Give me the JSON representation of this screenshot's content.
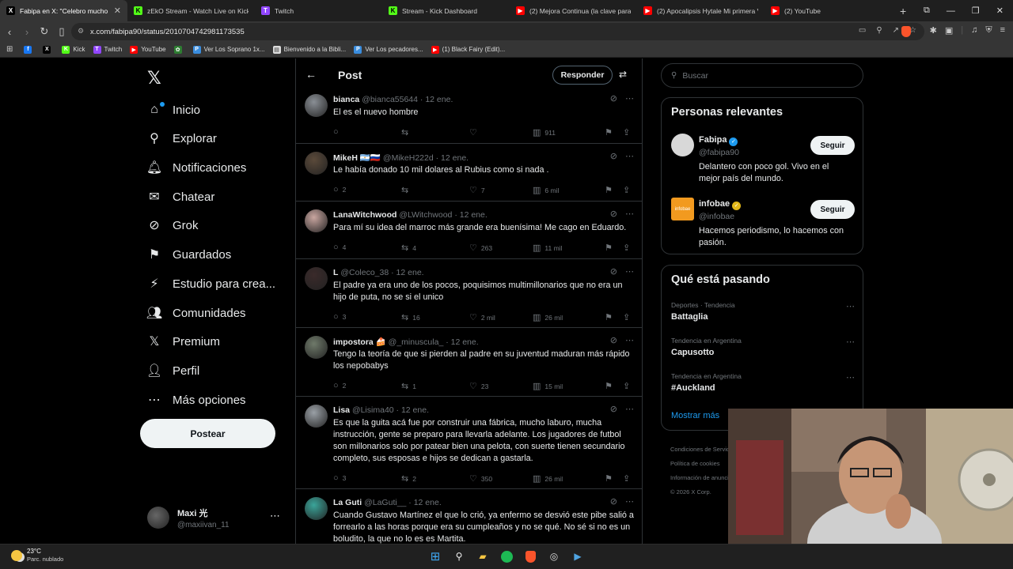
{
  "browser": {
    "tabs": [
      {
        "label": "Fabipa en X: \"Celebro mucho",
        "favicon": "X",
        "fav_color": "#000000",
        "active": true
      },
      {
        "label": "zEkO Stream - Watch Live on Kick",
        "favicon": "K",
        "fav_color": "#53fc18",
        "active": false
      },
      {
        "label": "Twitch",
        "favicon": "T",
        "fav_color": "#9146ff",
        "active": false
      },
      {
        "label": "Stream - Kick Dashboard",
        "favicon": "K",
        "fav_color": "#53fc18",
        "active": false
      },
      {
        "label": "(2) Mejora Continua (la clave para pr",
        "favicon": "▶",
        "fav_color": "#ff0000",
        "active": false
      },
      {
        "label": "(2) Apocalipsis Hytale Mi primera Ve",
        "favicon": "▶",
        "fav_color": "#ff0000",
        "active": false
      },
      {
        "label": "(2) YouTube",
        "favicon": "▶",
        "fav_color": "#ff0000",
        "active": false
      }
    ],
    "url": "x.com/fabipa90/status/2010704742981173535",
    "bookmarks": [
      {
        "label": "",
        "color": "#1877f2",
        "icon": "f"
      },
      {
        "label": "",
        "color": "#000000",
        "icon": "X"
      },
      {
        "label": "Kick",
        "color": "#53fc18",
        "icon": "K"
      },
      {
        "label": "Twitch",
        "color": "#9146ff",
        "icon": "T"
      },
      {
        "label": "YouTube",
        "color": "#ff0000",
        "icon": "▶"
      },
      {
        "label": "",
        "color": "#2e7d32",
        "icon": "✿"
      },
      {
        "label": "Ver Los Soprano 1x...",
        "color": "#3a8dde",
        "icon": "P"
      },
      {
        "label": "Bienvenido a la Bibli...",
        "color": "#dddddd",
        "icon": "▤"
      },
      {
        "label": "Ver Los pecadores...",
        "color": "#3a8dde",
        "icon": "P"
      },
      {
        "label": "(1) Black Fairy (Edit)...",
        "color": "#ff0000",
        "icon": "▶"
      }
    ]
  },
  "sidebar": {
    "items": [
      {
        "label": "Inicio",
        "icon": "home-icon",
        "glyph": "⌂"
      },
      {
        "label": "Explorar",
        "icon": "search-icon",
        "glyph": "⚲"
      },
      {
        "label": "Notificaciones",
        "icon": "bell-icon",
        "glyph": "🔔︎"
      },
      {
        "label": "Chatear",
        "icon": "chat-icon",
        "glyph": "✉"
      },
      {
        "label": "Grok",
        "icon": "grok-icon",
        "glyph": "⊘"
      },
      {
        "label": "Guardados",
        "icon": "bookmark-icon",
        "glyph": "⚑"
      },
      {
        "label": "Estudio para crea...",
        "icon": "studio-icon",
        "glyph": "⚡"
      },
      {
        "label": "Comunidades",
        "icon": "communities-icon",
        "glyph": "👥︎"
      },
      {
        "label": "Premium",
        "icon": "x-premium-icon",
        "glyph": "𝕏"
      },
      {
        "label": "Perfil",
        "icon": "person-icon",
        "glyph": "👤︎"
      },
      {
        "label": "Más opciones",
        "icon": "more-options-icon",
        "glyph": "⋯"
      }
    ],
    "post_button": "Postear",
    "account": {
      "name": "Maxi 光",
      "handle": "@maxiivan_11"
    }
  },
  "main": {
    "title": "Post",
    "reply_button": "Responder",
    "replies": [
      {
        "name": "bianca",
        "handle": "@bianca55644",
        "date": "· 12 ene.",
        "text": "El es el nuevo hombre",
        "replies": "",
        "reposts": "",
        "likes": "",
        "views": "911",
        "avatar_color": "#8a8f95"
      },
      {
        "name": "MikeH 🇦🇷🇷🇺",
        "handle": "@MikeH222d",
        "date": "· 12 ene.",
        "text": "Le había donado 10 mil dolares al Rubius como si nada .",
        "replies": "2",
        "reposts": "",
        "likes": "7",
        "views": "6 mil",
        "avatar_color": "#5b4a3a"
      },
      {
        "name": "LanaWitchwood",
        "handle": "@LWitchwood",
        "date": "· 12 ene.",
        "text": "Para mí su idea del marroc más grande era buenísima! Me cago en Eduardo.",
        "replies": "4",
        "reposts": "4",
        "likes": "263",
        "views": "11 mil",
        "avatar_color": "#c9a6a0"
      },
      {
        "name": "L",
        "handle": "@Coleco_38",
        "date": "· 12 ene.",
        "text": "El padre ya era uno de los pocos, poquisimos multimillonarios que no era un hijo de puta, no se si el unico",
        "replies": "3",
        "reposts": "16",
        "likes": "2 mil",
        "views": "26 mil",
        "avatar_color": "#3a2a2a"
      },
      {
        "name": "impostora 🍰",
        "handle": "@_minuscula_",
        "date": "· 12 ene.",
        "text": "Tengo la teoría de que si pierden al padre en su juventud maduran más rápido los nepobabys",
        "replies": "2",
        "reposts": "1",
        "likes": "23",
        "views": "15 mil",
        "avatar_color": "#6f7a6a"
      },
      {
        "name": "Lisa",
        "handle": "@Lisima40",
        "date": "· 12 ene.",
        "text": "Es que la guita acá fue por construir una fábrica, mucho laburo, mucha instrucción, gente se preparo para llevarla adelante. Los jugadores de futbol son millonarios solo por patear bien una pelota, con suerte tienen secundario completo, sus esposas e hijos se dedican a gastarla.",
        "replies": "3",
        "reposts": "2",
        "likes": "350",
        "views": "26 mil",
        "avatar_color": "#9aa0a6"
      },
      {
        "name": "La Guti",
        "handle": "@LaGuti__",
        "date": "· 12 ene.",
        "text": "Cuando Gustavo Martínez el que lo crió, ya enfermo se desvió este pibe salió a forrearlo a las horas porque era su cumpleaños y no se qué. No sé si no es un boludito, la que no lo es es Martita.",
        "replies": "",
        "reposts": "",
        "likes": "",
        "views": "",
        "avatar_color": "#3aa59a"
      }
    ]
  },
  "right": {
    "search_placeholder": "Buscar",
    "relevant_title": "Personas relevantes",
    "people": [
      {
        "name": "Fabipa",
        "handle": "@fabipa90",
        "bio": "Delantero con poco gol. Vivo en el mejor país del mundo.",
        "button": "Seguir",
        "badge": "blue",
        "avatar_color": "#d8d8d8"
      },
      {
        "name": "infobae",
        "handle": "@infobae",
        "bio": "Hacemos periodismo, lo hacemos con pasión.",
        "button": "Seguir",
        "badge": "gold",
        "avatar_color": "#f29a1f",
        "avatar_text": "infobae"
      }
    ],
    "trends_title": "Qué está pasando",
    "trends": [
      {
        "meta": "Deportes · Tendencia",
        "name": "Battaglia"
      },
      {
        "meta": "Tendencia en Argentina",
        "name": "Capusotto"
      },
      {
        "meta": "Tendencia en Argentina",
        "name": "#Auckland"
      }
    ],
    "show_more": "Mostrar más",
    "footer": [
      "Condiciones de Servicio",
      "Política de cookies",
      "Información de anuncios",
      "© 2026 X Corp."
    ]
  },
  "taskbar": {
    "temp": "23°C",
    "condition": "Parc. nublado"
  }
}
